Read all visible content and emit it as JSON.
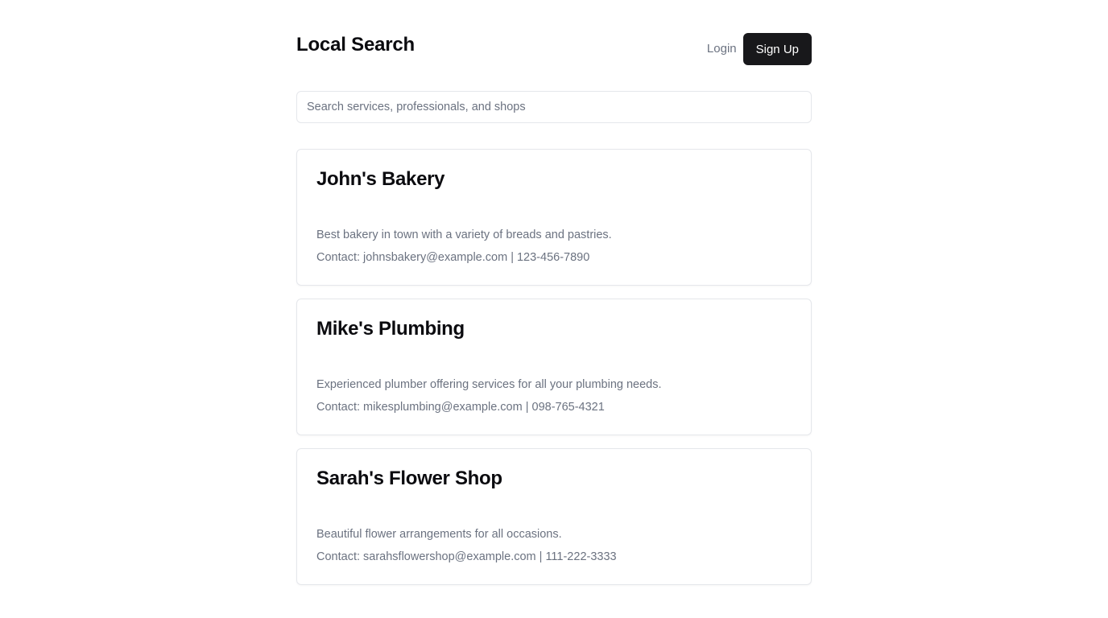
{
  "header": {
    "title": "Local Search",
    "login_label": "Login",
    "signup_label": "Sign Up"
  },
  "search": {
    "placeholder": "Search services, professionals, and shops",
    "value": ""
  },
  "listings": [
    {
      "name": "John's Bakery",
      "description": "Best bakery in town with a variety of breads and pastries.",
      "contact": "Contact: johnsbakery@example.com | 123-456-7890"
    },
    {
      "name": "Mike's Plumbing",
      "description": "Experienced plumber offering services for all your plumbing needs.",
      "contact": "Contact: mikesplumbing@example.com | 098-765-4321"
    },
    {
      "name": "Sarah's Flower Shop",
      "description": "Beautiful flower arrangements for all occasions.",
      "contact": "Contact: sarahsflowershop@example.com | 111-222-3333"
    }
  ],
  "colors": {
    "primary_button": "#18181b",
    "muted_text": "#6b7280",
    "border": "#e5e7eb"
  }
}
